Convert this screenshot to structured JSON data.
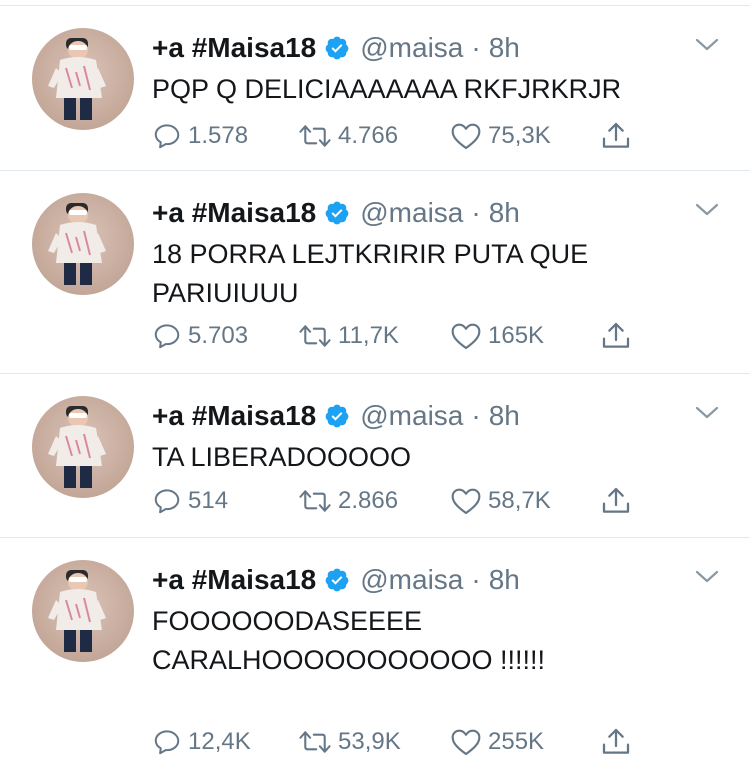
{
  "author": {
    "display_name": "+a #Maisa18",
    "handle": "@maisa",
    "verified": true,
    "separator": "·"
  },
  "colors": {
    "verified_badge": "#1da1f2",
    "text": "#14171a",
    "secondary": "#657786",
    "divider": "#e1e8ed"
  },
  "icons": {
    "reply": "reply-icon",
    "retweet": "retweet-icon",
    "like": "heart-icon",
    "share": "share-icon",
    "more": "chevron-down-icon",
    "verified": "verified-badge-icon"
  },
  "tweets": [
    {
      "time": "8h",
      "text": "PQP Q DELICIAAAAAAA RKFJRKRJR",
      "replies": "1.578",
      "retweets": "4.766",
      "likes": "75,3K"
    },
    {
      "time": "8h",
      "text": "18 PORRA LEJTKRIRIR PUTA QUE PARIUIUUU",
      "replies": "5.703",
      "retweets": "11,7K",
      "likes": "165K"
    },
    {
      "time": "8h",
      "text": "TA LIBERADOOOOO",
      "replies": "514",
      "retweets": "2.866",
      "likes": "58,7K"
    },
    {
      "time": "8h",
      "text": "FOOOOOODASEEEE CARALHOOOOOOOOOOO !!!!!!",
      "replies": "12,4K",
      "retweets": "53,9K",
      "likes": "255K"
    }
  ]
}
